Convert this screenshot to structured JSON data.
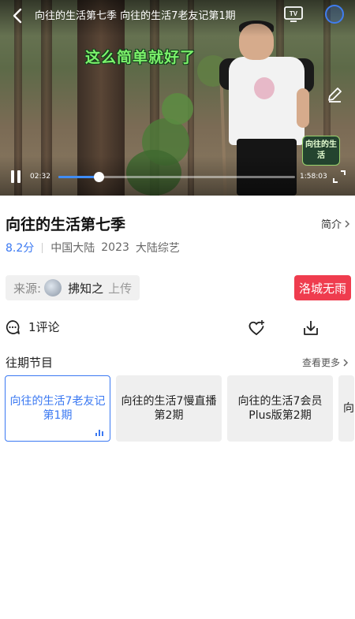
{
  "player": {
    "title": "向往的生活第七季 向往的生活7老友记第1期",
    "subtitle": "这么简单就好了",
    "watermark": "向往的生活",
    "time_current": "02:32",
    "time_total": "1:58:03",
    "progress_fraction": 0.17
  },
  "info": {
    "title": "向往的生活第七季",
    "intro_label": "简介",
    "rating": "8.2分",
    "region": "中国大陆",
    "year": "2023",
    "genre": "大陆综艺"
  },
  "source": {
    "label": "来源:",
    "uploader": "拂知之",
    "upload_tag": "上传",
    "promo_badge": "洛城无雨"
  },
  "actions": {
    "comments": "1评论"
  },
  "episodes_section": {
    "title": "往期节目",
    "more_label": "查看更多",
    "items": [
      {
        "label": "向往的生活7老友记第1期"
      },
      {
        "label": "向往的生活7慢直播第2期"
      },
      {
        "label": "向往的生活7会员Plus版第2期"
      },
      {
        "label": "向"
      }
    ]
  },
  "colors": {
    "accent": "#3a78f2",
    "promo": "#ef3c4e",
    "subtitle_text": "#7cf26b"
  }
}
